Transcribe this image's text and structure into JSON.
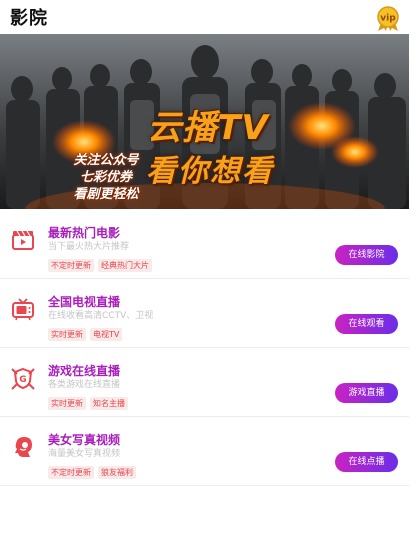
{
  "header": {
    "title": "影院",
    "vip_label": "vip",
    "vip_icon": "vip-badge-icon"
  },
  "banner": {
    "title": "云播TV",
    "slogan": "看你想看",
    "side_lines": [
      "关注公众号",
      "七彩优券",
      "看剧更轻松"
    ]
  },
  "colors": {
    "accent": "#a91ebd",
    "tag_text": "#e8474f",
    "tag_bg": "#f9eaea",
    "button_start": "#c923c2",
    "button_end": "#6a2ee8",
    "icon_red": "#e8474f"
  },
  "items": [
    {
      "icon": "film-clapper-icon",
      "name": "最新热门电影",
      "desc": "当下最火热大片推荐",
      "tags": [
        "不定时更新",
        "经典热门大片"
      ],
      "button": "在线影院"
    },
    {
      "icon": "tv-icon",
      "name": "全国电视直播",
      "desc": "在线收看高清CCTV、卫视",
      "tags": [
        "实时更新",
        "电视TV"
      ],
      "button": "在线观看"
    },
    {
      "icon": "game-shield-icon",
      "name": "游戏在线直播",
      "desc": "各类游戏在线直播",
      "tags": [
        "实时更新",
        "知名主播"
      ],
      "button": "游戏直播"
    },
    {
      "icon": "woman-profile-icon",
      "name": "美女写真视频",
      "desc": "海量美女写真视频",
      "tags": [
        "不定时更新",
        "狼友福利"
      ],
      "button": "在线点播"
    }
  ]
}
